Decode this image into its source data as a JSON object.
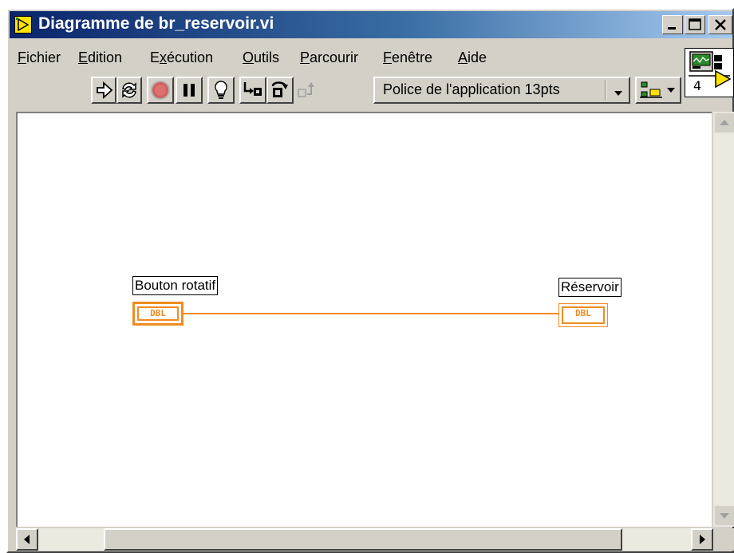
{
  "window": {
    "title": "Diagramme de br_reservoir.vi"
  },
  "menubar": {
    "items": [
      {
        "mnemonic": "F",
        "rest": "ichier"
      },
      {
        "mnemonic": "E",
        "rest": "dition"
      },
      {
        "pre": "E",
        "mnemonic": "x",
        "rest": "écution"
      },
      {
        "mnemonic": "O",
        "rest": "utils"
      },
      {
        "mnemonic": "P",
        "rest": "arcourir"
      },
      {
        "mnemonic": "F",
        "rest": "enêtre"
      },
      {
        "mnemonic": "A",
        "rest": "ide"
      }
    ]
  },
  "toolbar": {
    "tools": [
      "run-arrow",
      "run-continuously",
      "abort",
      "pause",
      "highlight-execution",
      "step-into",
      "step-over",
      "step-out"
    ],
    "font_ring": "Police de l'application 13pts",
    "connector_number": "4"
  },
  "diagram": {
    "control_label": "Bouton rotatif",
    "control_type": "DBL",
    "indicator_label": "Réservoir",
    "indicator_type": "DBL",
    "wire_color": "#f08c1e"
  }
}
